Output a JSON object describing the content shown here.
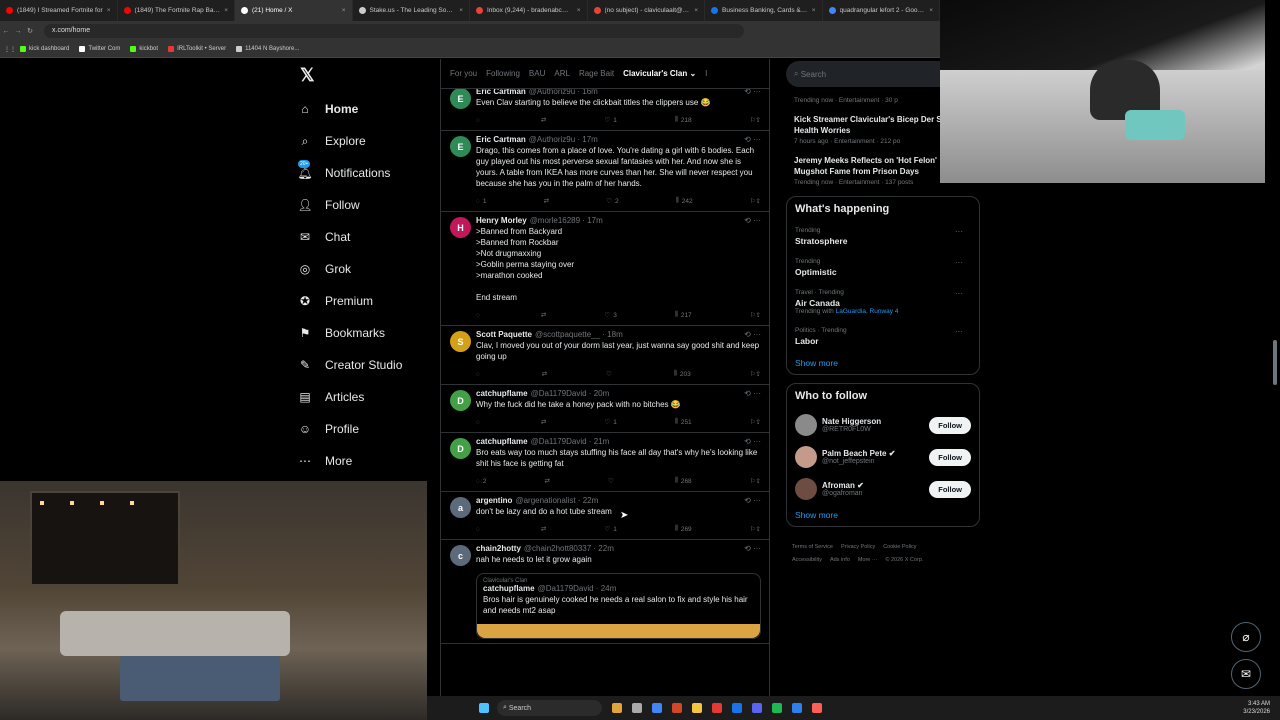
{
  "browser": {
    "tabs": [
      {
        "label": "(1849) I Streamed Fortnite for",
        "color": "#ff0000"
      },
      {
        "label": "(1849) The Fortnite Rap Battle",
        "color": "#ff0000"
      },
      {
        "label": "(21) Home / X",
        "color": "#ffffff",
        "active": true
      },
      {
        "label": "Stake.us - The Leading Social C",
        "color": "#cccccc"
      },
      {
        "label": "Inbox (9,244) - bradenabc@gm",
        "color": "#ea4335"
      },
      {
        "label": "(no subject) - claviculaalt@gm",
        "color": "#ea4335"
      },
      {
        "label": "Business Banking, Cards & Tra",
        "color": "#1a73e8"
      },
      {
        "label": "quadrangular lefort 2 - Google",
        "color": "#4285f4"
      }
    ],
    "url": "x.com/home",
    "bookmarks": [
      {
        "label": "kick dashboard",
        "color": "#53fc18"
      },
      {
        "label": "Twitter Com",
        "color": "#ffffff"
      },
      {
        "label": "kickbot",
        "color": "#53fc18"
      },
      {
        "label": "IRLToolkit • Server",
        "color": "#e53935"
      },
      {
        "label": "11404 N Bayshore...",
        "color": "#cccccc"
      }
    ]
  },
  "nav": {
    "logo": "𝕏",
    "items": [
      {
        "icon": "⌂",
        "label": "Home"
      },
      {
        "icon": "⌕",
        "label": "Explore"
      },
      {
        "icon": "🔔︎",
        "label": "Notifications",
        "badge": "20+"
      },
      {
        "icon": "👤︎",
        "label": "Follow"
      },
      {
        "icon": "✉",
        "label": "Chat"
      },
      {
        "icon": "◎",
        "label": "Grok"
      },
      {
        "icon": "✪",
        "label": "Premium"
      },
      {
        "icon": "⚑",
        "label": "Bookmarks"
      },
      {
        "icon": "✎",
        "label": "Creator Studio"
      },
      {
        "icon": "▤",
        "label": "Articles"
      },
      {
        "icon": "☺",
        "label": "Profile"
      },
      {
        "icon": "⋯",
        "label": "More"
      }
    ]
  },
  "feed": {
    "tabs": [
      "For you",
      "Following",
      "BAU",
      "ARL",
      "Rage Bait",
      "Clavicular's Clan ⌄",
      "I"
    ],
    "posts": [
      {
        "name": "Eric Cartman",
        "handle": "@Authoriz9u · 16m",
        "text": "Even Clav starting to believe the clickbait titles the clippers use 😂",
        "reply": "",
        "like": "1",
        "views": "218",
        "avatar": "E",
        "avColor": "#2e8b57"
      },
      {
        "name": "Eric Cartman",
        "handle": "@Authoriz9u · 17m",
        "text": "Drago, this comes from a place of love. You're dating a girl with 6 bodies. Each guy played out his most perverse sexual fantasies with her. And now she is yours. A table from IKEA has more curves than her. She will never respect you because she has you in the palm of her hands.",
        "reply": "1",
        "like": "2",
        "views": "242",
        "avatar": "E",
        "avColor": "#2e8b57"
      },
      {
        "name": "Henry Morley",
        "handle": "@morle16289 · 17m",
        "text": ">Banned from Backyard\n>Banned from Rockbar\n>Not drugmaxxing\n>Goblin perma staying over\n>marathon cooked\n\nEnd stream",
        "reply": "",
        "like": "3",
        "views": "217",
        "avatar": "H",
        "avColor": "#c2185b"
      },
      {
        "name": "Scott Paquette",
        "handle": "@scottpaquette__ · 18m",
        "text": "Clav, I moved you out of your dorm last year, just wanna say good shit and keep going up",
        "reply": "",
        "like": "",
        "views": "203",
        "avatar": "S",
        "avColor": "#d4a017"
      },
      {
        "name": "catchupflame",
        "handle": "@Da1179David · 20m",
        "text": "Why the fuck did he take a honey pack with no bitches 😂",
        "reply": "",
        "like": "1",
        "views": "251",
        "avatar": "D",
        "avColor": "#43a047"
      },
      {
        "name": "catchupflame",
        "handle": "@Da1179David · 21m",
        "text": "Bro eats way too much stays stuffing his face all day that's why he's looking like shit his face is getting fat",
        "reply": "2",
        "like": "",
        "views": "268",
        "avatar": "D",
        "avColor": "#43a047"
      },
      {
        "name": "argentino",
        "handle": "@argenationalist · 22m",
        "text": "don't be lazy and do a hot tube stream",
        "reply": "",
        "like": "1",
        "views": "269",
        "avatar": "a",
        "avColor": "#5b6b7a"
      },
      {
        "name": "chain2hotty",
        "handle": "@chain2hott80337 · 22m",
        "text": "nah he needs to let it grow again",
        "reply": "",
        "like": "",
        "views": "",
        "avatar": "c",
        "avColor": "#5b6b7a",
        "quote": {
          "community": "Clavicular's Clan",
          "name": "catchupflame",
          "handle": "@Da1179David · 24m",
          "text": "Bros hair is genuinely cooked he needs a real salon to fix and style his hair and needs mt2 asap"
        }
      }
    ]
  },
  "right": {
    "search_placeholder": "Search",
    "top_trends": [
      {
        "title": "",
        "meta": "Trending now · Entertainment · 30 p"
      },
      {
        "title": "Kick Streamer Clavicular's Bicep Der Sparks Health Worries",
        "meta": "7 hours ago · Entertainment · 212 po"
      },
      {
        "title": "Jeremy Meeks Reflects on 'Hot Felon' Mugshot Fame from Prison Days",
        "meta": "Trending now · Entertainment · 137 posts"
      }
    ],
    "whats_happening": {
      "title": "What's happening",
      "items": [
        {
          "cat": "Trending",
          "topic": "Stratosphere",
          "sub": ""
        },
        {
          "cat": "Trending",
          "topic": "Optimistic",
          "sub": ""
        },
        {
          "cat": "Travel · Trending",
          "topic": "Air Canada",
          "sub_prefix": "Trending with ",
          "sub": "LaGuardia, Runway 4"
        },
        {
          "cat": "Politics · Trending",
          "topic": "Labor",
          "sub": ""
        }
      ],
      "show_more": "Show more"
    },
    "who_to_follow": {
      "title": "Who to follow",
      "people": [
        {
          "name": "Nate Higgerson",
          "handle": "@RETR0FL0W",
          "color": "#8a8a8a"
        },
        {
          "name": "Palm Beach Pete ✔",
          "handle": "@not_jeffepstein",
          "color": "#c49a8a"
        },
        {
          "name": "Afroman ✔",
          "handle": "@ogafroman",
          "color": "#6d4c41"
        }
      ],
      "button": "Follow",
      "show_more": "Show more"
    },
    "footer": [
      "Terms of Service",
      "Privacy Policy",
      "Cookie Policy",
      "Accessibility",
      "Ads info",
      "More ···",
      "© 2026 X Corp."
    ]
  },
  "taskbar": {
    "search": "Search",
    "time": "3:43 AM",
    "date": "3/23/2026"
  }
}
